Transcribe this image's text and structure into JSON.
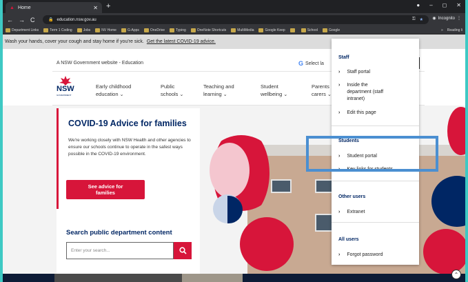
{
  "browser": {
    "tab_title": "Home",
    "new_tab": "+",
    "url": "education.nsw.gov.au",
    "incognito": "Incognito",
    "reading_list": "Reading li",
    "bookmarks": [
      "Department Links",
      "Term 1 Coding",
      "Jobs",
      "NV Home",
      "G-Apps",
      "OneDrive",
      "Typing",
      "OneNote Shortcuts",
      "MultiMedia",
      "Google Keep",
      "",
      "School",
      "Google"
    ],
    "back": "←",
    "forward": "→",
    "reload": "C",
    "more": "»"
  },
  "banner": {
    "text": "Wash your hands, cover your cough and stay home if you're sick.",
    "link": "Get the latest COVID-19 advice."
  },
  "gov": {
    "text": "A NSW Government website - Education",
    "translate": "Select la"
  },
  "logo": {
    "word": "NSW",
    "sub": "GOVERNMENT"
  },
  "nav": [
    {
      "l1": "Early childhood",
      "l2": "education"
    },
    {
      "l1": "Public",
      "l2": "schools"
    },
    {
      "l1": "Teaching and",
      "l2": "learning"
    },
    {
      "l1": "Student",
      "l2": "wellbeing"
    },
    {
      "l1": "Parents",
      "l2": "carers"
    }
  ],
  "hero": {
    "title": "COVID-19 Advice for families",
    "body": "We're working closely with NSW Health and other agencies to ensure our schools continue to operate in the safest ways possible in the COVID-19 environment.",
    "button_l1": "See advice for",
    "button_l2": "families"
  },
  "search": {
    "title": "Search public department content",
    "placeholder": "Enter your search..."
  },
  "menu": {
    "staff_heading": "Staff",
    "staff_portal": "Staff portal",
    "inside_l1": "Inside the",
    "inside_l2": "department (staff",
    "inside_l3": "intranet)",
    "edit_page": "Edit this page",
    "students_heading": "Students",
    "student_portal": "Student portal",
    "key_links": "Key links for students",
    "other_heading": "Other users",
    "extranet": "Extranet",
    "all_heading": "All users",
    "forgot": "Forgot password"
  },
  "colors": {
    "nsw_red": "#d7153a",
    "nsw_navy": "#002664",
    "highlight": "#4b8fd1"
  }
}
